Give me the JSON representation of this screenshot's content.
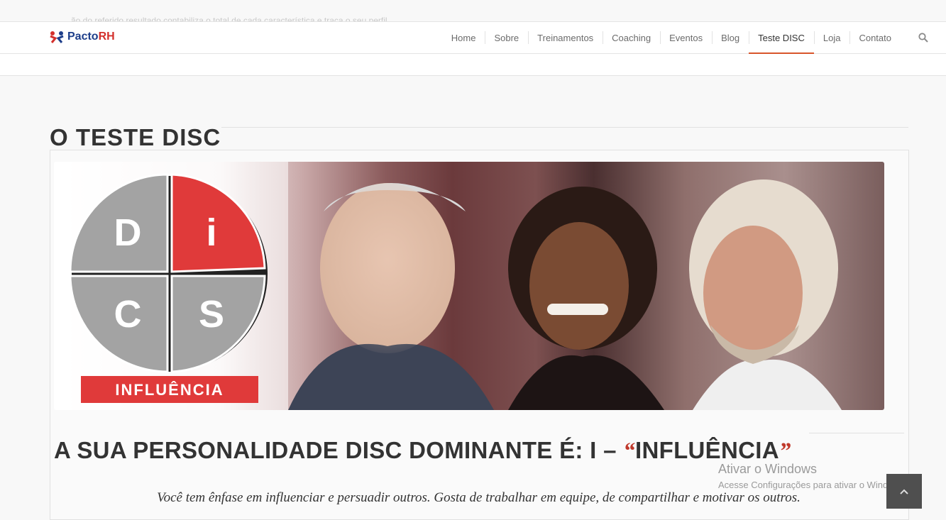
{
  "topbar": {
    "ghost_text": "...ão do referido resultado contabiliza o total de cada característica e traça o seu perfil."
  },
  "logo": {
    "name_part1": "Pacto",
    "name_part2": "RH"
  },
  "nav": {
    "items": [
      {
        "label": "Home"
      },
      {
        "label": "Sobre"
      },
      {
        "label": "Treinamentos"
      },
      {
        "label": "Coaching"
      },
      {
        "label": "Eventos"
      },
      {
        "label": "Blog"
      },
      {
        "label": "Teste DISC",
        "active": true
      },
      {
        "label": "Loja"
      },
      {
        "label": "Contato"
      }
    ],
    "search_icon": "search-icon"
  },
  "page": {
    "title_prefix": "O",
    "title_bold": "TESTE DISC"
  },
  "banner": {
    "quadrants": [
      "D",
      "i",
      "C",
      "S"
    ],
    "label": "INFLUÊNCIA",
    "colors": {
      "highlight": "#e03a3a",
      "quadrant": "#a3a3a3"
    }
  },
  "result": {
    "heading_prefix": "A SUA PERSONALIDADE DISC DOMINANTE É: I –",
    "open_quote": "“",
    "heading_bold": "INFLUÊNCIA",
    "close_quote": "”",
    "description": "Você tem ênfase em influenciar e persuadir outros. Gosta de trabalhar em equipe, de compartilhar e motivar os outros."
  },
  "watermark": {
    "line1": "Ativar o Windows",
    "line2": "Acesse Configurações para ativar o Windows."
  },
  "accent": "#d8552b"
}
